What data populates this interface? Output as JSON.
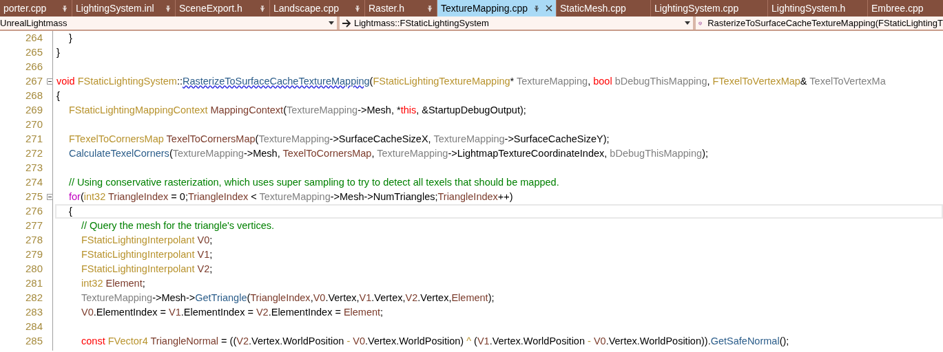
{
  "tabs": [
    {
      "label": "porter.cpp",
      "pinned": true,
      "selected": false
    },
    {
      "label": "LightingSystem.inl",
      "pinned": true,
      "selected": false
    },
    {
      "label": "SceneExport.h",
      "pinned": true,
      "selected": false
    },
    {
      "label": "Landscape.cpp",
      "pinned": true,
      "selected": false
    },
    {
      "label": "Raster.h",
      "pinned": true,
      "selected": false
    },
    {
      "label": "TextureMapping.cpp",
      "pinned": true,
      "selected": true
    },
    {
      "label": "StaticMesh.cpp",
      "pinned": false,
      "selected": false
    },
    {
      "label": "LightingSystem.cpp",
      "pinned": false,
      "selected": false
    },
    {
      "label": "LightingSystem.h",
      "pinned": false,
      "selected": false
    },
    {
      "label": "Embree.cpp",
      "pinned": false,
      "selected": false
    }
  ],
  "navigation": {
    "project": "UnrealLightmass",
    "scope": "Lightmass::FStaticLightingSystem",
    "member": "RasterizeToSurfaceCacheTextureMapping(FStaticLightingT"
  },
  "lines": [
    {
      "number": "264",
      "tokens": [
        {
          "text": "\t}",
          "kind": "plain"
        }
      ]
    },
    {
      "number": "265",
      "tokens": [
        {
          "text": "}",
          "kind": "plain"
        }
      ]
    },
    {
      "number": "266"
    },
    {
      "number": "267",
      "fold": true,
      "tokens": [
        {
          "text": "void ",
          "kind": "keyword"
        },
        {
          "text": "FStaticLightingSystem",
          "kind": "type"
        },
        {
          "text": "::",
          "kind": "plain"
        },
        {
          "text": "RasterizeToSurfaceCacheTextureMapping",
          "kind": "function",
          "squiggle": true
        },
        {
          "text": "(",
          "kind": "plain"
        },
        {
          "text": "FStaticLightingTextureMapping",
          "kind": "type"
        },
        {
          "text": "* ",
          "kind": "plain"
        },
        {
          "text": "TextureMapping",
          "kind": "param"
        },
        {
          "text": ", ",
          "kind": "plain"
        },
        {
          "text": "bool",
          "kind": "keyword"
        },
        {
          "text": " bDebugThisMapping",
          "kind": "param"
        },
        {
          "text": ", ",
          "kind": "plain"
        },
        {
          "text": "FTexelToVertexMap",
          "kind": "type"
        },
        {
          "text": "& ",
          "kind": "plain"
        },
        {
          "text": "TexelToVertexMa",
          "kind": "param"
        }
      ]
    },
    {
      "number": "268",
      "tokens": [
        {
          "text": "{",
          "kind": "plain"
        }
      ]
    },
    {
      "number": "269",
      "tokens": [
        {
          "text": "\tFStaticLightingMappingContext",
          "kind": "type"
        },
        {
          "text": " MappingContext",
          "kind": "local"
        },
        {
          "text": "(",
          "kind": "plain"
        },
        {
          "text": "TextureMapping",
          "kind": "param"
        },
        {
          "text": "->Mesh, *",
          "kind": "plain"
        },
        {
          "text": "this",
          "kind": "keyword"
        },
        {
          "text": ", &StartupDebugOutput);",
          "kind": "plain"
        }
      ]
    },
    {
      "number": "270"
    },
    {
      "number": "271",
      "tokens": [
        {
          "text": "\tFTexelToCornersMap",
          "kind": "type"
        },
        {
          "text": " TexelToCornersMap",
          "kind": "local"
        },
        {
          "text": "(",
          "kind": "plain"
        },
        {
          "text": "TextureMapping",
          "kind": "param"
        },
        {
          "text": "->SurfaceCacheSizeX, ",
          "kind": "plain"
        },
        {
          "text": "TextureMapping",
          "kind": "param"
        },
        {
          "text": "->SurfaceCacheSizeY);",
          "kind": "plain"
        }
      ]
    },
    {
      "number": "272",
      "tokens": [
        {
          "text": "\tCalculateTexelCorners",
          "kind": "function"
        },
        {
          "text": "(",
          "kind": "plain"
        },
        {
          "text": "TextureMapping",
          "kind": "param"
        },
        {
          "text": "->Mesh, ",
          "kind": "plain"
        },
        {
          "text": "TexelToCornersMap",
          "kind": "local"
        },
        {
          "text": ", ",
          "kind": "plain"
        },
        {
          "text": "TextureMapping",
          "kind": "param"
        },
        {
          "text": "->LightmapTextureCoordinateIndex, ",
          "kind": "plain"
        },
        {
          "text": "bDebugThisMapping",
          "kind": "param"
        },
        {
          "text": ");",
          "kind": "plain"
        }
      ]
    },
    {
      "number": "273"
    },
    {
      "number": "274",
      "tokens": [
        {
          "text": "\t// Using conservative rasterization, which uses super sampling to try to detect all texels that should be mapped.",
          "kind": "comment"
        }
      ]
    },
    {
      "number": "275",
      "fold": true,
      "tokens": [
        {
          "text": "\tfor",
          "kind": "control"
        },
        {
          "text": "(",
          "kind": "plain"
        },
        {
          "text": "int32",
          "kind": "type"
        },
        {
          "text": " TriangleIndex",
          "kind": "local"
        },
        {
          "text": " = 0;",
          "kind": "plain"
        },
        {
          "text": "TriangleIndex",
          "kind": "local"
        },
        {
          "text": " < ",
          "kind": "plain"
        },
        {
          "text": "TextureMapping",
          "kind": "param"
        },
        {
          "text": "->Mesh->NumTriangles;",
          "kind": "plain"
        },
        {
          "text": "TriangleIndex",
          "kind": "local"
        },
        {
          "text": "++)",
          "kind": "plain"
        }
      ]
    },
    {
      "number": "276",
      "current": true,
      "tokens": [
        {
          "text": "\t{",
          "kind": "plain"
        }
      ]
    },
    {
      "number": "277",
      "tokens": [
        {
          "text": "\t\t// Query the mesh for the triangle's vertices.",
          "kind": "comment"
        }
      ]
    },
    {
      "number": "278",
      "tokens": [
        {
          "text": "\t\tFStaticLightingInterpolant",
          "kind": "type"
        },
        {
          "text": " V0",
          "kind": "local"
        },
        {
          "text": ";",
          "kind": "plain"
        }
      ]
    },
    {
      "number": "279",
      "tokens": [
        {
          "text": "\t\tFStaticLightingInterpolant",
          "kind": "type"
        },
        {
          "text": " V1",
          "kind": "local"
        },
        {
          "text": ";",
          "kind": "plain"
        }
      ]
    },
    {
      "number": "280",
      "tokens": [
        {
          "text": "\t\tFStaticLightingInterpolant",
          "kind": "type"
        },
        {
          "text": " V2",
          "kind": "local"
        },
        {
          "text": ";",
          "kind": "plain"
        }
      ]
    },
    {
      "number": "281",
      "tokens": [
        {
          "text": "\t\tint32",
          "kind": "type"
        },
        {
          "text": " Element",
          "kind": "local"
        },
        {
          "text": ";",
          "kind": "plain"
        }
      ]
    },
    {
      "number": "282",
      "tokens": [
        {
          "text": "\t\tTextureMapping",
          "kind": "param"
        },
        {
          "text": "->Mesh->",
          "kind": "plain"
        },
        {
          "text": "GetTriangle",
          "kind": "function"
        },
        {
          "text": "(",
          "kind": "plain"
        },
        {
          "text": "TriangleIndex",
          "kind": "local"
        },
        {
          "text": ",",
          "kind": "plain"
        },
        {
          "text": "V0",
          "kind": "local"
        },
        {
          "text": ".Vertex,",
          "kind": "plain"
        },
        {
          "text": "V1",
          "kind": "local"
        },
        {
          "text": ".Vertex,",
          "kind": "plain"
        },
        {
          "text": "V2",
          "kind": "local"
        },
        {
          "text": ".Vertex,",
          "kind": "plain"
        },
        {
          "text": "Element",
          "kind": "local"
        },
        {
          "text": ");",
          "kind": "plain"
        }
      ]
    },
    {
      "number": "283",
      "tokens": [
        {
          "text": "\t\tV0",
          "kind": "local"
        },
        {
          "text": ".ElementIndex = ",
          "kind": "plain"
        },
        {
          "text": "V1",
          "kind": "local"
        },
        {
          "text": ".ElementIndex = ",
          "kind": "plain"
        },
        {
          "text": "V2",
          "kind": "local"
        },
        {
          "text": ".ElementIndex = ",
          "kind": "plain"
        },
        {
          "text": "Element",
          "kind": "local"
        },
        {
          "text": ";",
          "kind": "plain"
        }
      ]
    },
    {
      "number": "284"
    },
    {
      "number": "285",
      "tokens": [
        {
          "text": "\t\tconst ",
          "kind": "keyword"
        },
        {
          "text": "FVector4",
          "kind": "type"
        },
        {
          "text": " TriangleNormal",
          "kind": "local"
        },
        {
          "text": " = ((",
          "kind": "plain"
        },
        {
          "text": "V2",
          "kind": "local"
        },
        {
          "text": ".Vertex.WorldPosition ",
          "kind": "plain"
        },
        {
          "text": "- ",
          "kind": "operator"
        },
        {
          "text": "V0",
          "kind": "local"
        },
        {
          "text": ".Vertex.WorldPosition) ",
          "kind": "plain"
        },
        {
          "text": "^",
          "kind": "operator"
        },
        {
          "text": " (",
          "kind": "plain"
        },
        {
          "text": "V1",
          "kind": "local"
        },
        {
          "text": ".Vertex.WorldPosition ",
          "kind": "plain"
        },
        {
          "text": "- ",
          "kind": "operator"
        },
        {
          "text": "V0",
          "kind": "local"
        },
        {
          "text": ".Vertex.WorldPosition)).",
          "kind": "plain"
        },
        {
          "text": "GetSafeNormal",
          "kind": "function"
        },
        {
          "text": "();",
          "kind": "plain"
        }
      ]
    }
  ]
}
